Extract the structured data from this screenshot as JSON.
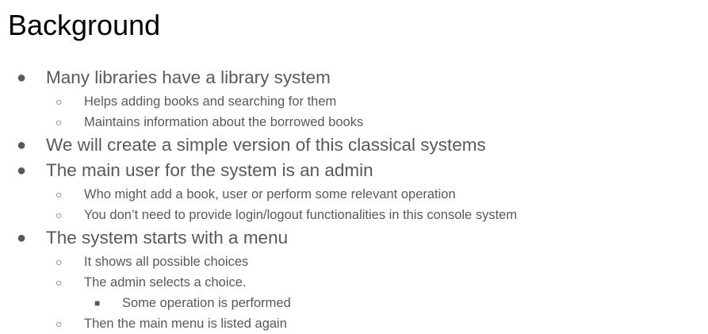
{
  "slide": {
    "title": "Background",
    "items": [
      {
        "level": 1,
        "text": "Many libraries have a library system"
      },
      {
        "level": 2,
        "text": "Helps adding books and searching for them"
      },
      {
        "level": 2,
        "text": "Maintains information about the borrowed books"
      },
      {
        "level": 1,
        "text": "We will create a simple version of this classical systems"
      },
      {
        "level": 1,
        "text": "The main user for the system is an admin"
      },
      {
        "level": 2,
        "text": "Who might add a book, user or perform some relevant operation"
      },
      {
        "level": 2,
        "text": "You don’t need to provide login/logout functionalities in this console system"
      },
      {
        "level": 1,
        "text": "The system starts with a menu"
      },
      {
        "level": 2,
        "text": "It shows all possible choices"
      },
      {
        "level": 2,
        "text": "The admin selects a choice."
      },
      {
        "level": 3,
        "text": "Some operation is performed"
      },
      {
        "level": 2,
        "text": "Then the main menu is listed again"
      }
    ]
  }
}
